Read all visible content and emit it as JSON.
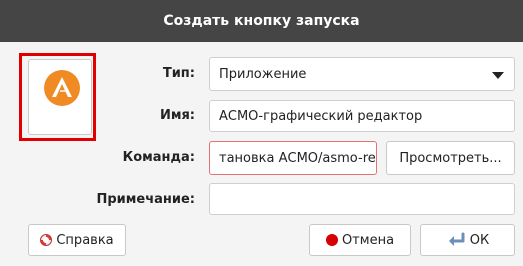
{
  "dialog": {
    "title": "Создать кнопку запуска"
  },
  "form": {
    "type_label": "Тип:",
    "type_value": "Приложение",
    "name_label": "Имя:",
    "name_value": "АСМО-графический редактор",
    "command_label": "Команда:",
    "command_value": "тановка АСМО/asmo-re\"",
    "browse_label": "Просмотреть...",
    "comment_label": "Примечание:",
    "comment_value": ""
  },
  "buttons": {
    "help_label": "Справка",
    "cancel_label": "Отмена",
    "ok_label": "ОК"
  },
  "colors": {
    "titlebar": "#454545",
    "icon_highlight": "#e00000",
    "app_icon": "#f08a24",
    "error_border": "#e57373",
    "cancel_icon": "#d50000"
  }
}
